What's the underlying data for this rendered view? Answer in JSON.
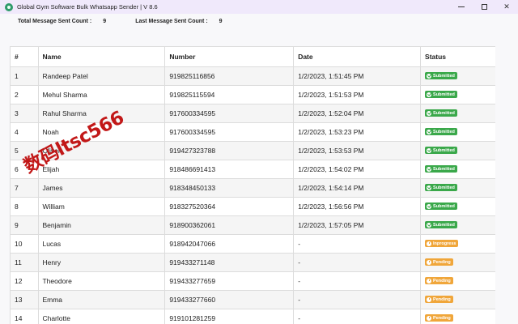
{
  "window": {
    "title": "Global Gym Software Bulk Whatsapp Sender | V 8.6",
    "controls": [
      "minimize",
      "maximize",
      "close"
    ],
    "close_glyph": "✕"
  },
  "counts": {
    "total_label": "Total Message Sent Count :",
    "total_value": "9",
    "last_label": "Last Message Sent Count :",
    "last_value": "9"
  },
  "table": {
    "headers": [
      "#",
      "Name",
      "Number",
      "Date",
      "Status"
    ],
    "rows": [
      {
        "n": "1",
        "name": "Randeep Patel",
        "number": "919825116856",
        "date": "1/2/2023, 1:51:45 PM",
        "status": "Submitted",
        "kind": "submitted"
      },
      {
        "n": "2",
        "name": "Mehul Sharma",
        "number": "919825115594",
        "date": "1/2/2023, 1:51:53 PM",
        "status": "Submitted",
        "kind": "submitted"
      },
      {
        "n": "3",
        "name": "Rahul Sharma",
        "number": "917600334595",
        "date": "1/2/2023, 1:52:04 PM",
        "status": "Submitted",
        "kind": "submitted"
      },
      {
        "n": "4",
        "name": "Noah",
        "number": "917600334595",
        "date": "1/2/2023, 1:53:23 PM",
        "status": "Submitted",
        "kind": "submitted"
      },
      {
        "n": "5",
        "name": "Oliver",
        "number": "919427323788",
        "date": "1/2/2023, 1:53:53 PM",
        "status": "Submitted",
        "kind": "submitted"
      },
      {
        "n": "6",
        "name": "Elijah",
        "number": "918486691413",
        "date": "1/2/2023, 1:54:02 PM",
        "status": "Submitted",
        "kind": "submitted"
      },
      {
        "n": "7",
        "name": "James",
        "number": "918348450133",
        "date": "1/2/2023, 1:54:14 PM",
        "status": "Submitted",
        "kind": "submitted"
      },
      {
        "n": "8",
        "name": "William",
        "number": "918327520364",
        "date": "1/2/2023, 1:56:56 PM",
        "status": "Submitted",
        "kind": "submitted"
      },
      {
        "n": "9",
        "name": "Benjamin",
        "number": "918900362061",
        "date": "1/2/2023, 1:57:05 PM",
        "status": "Submitted",
        "kind": "submitted"
      },
      {
        "n": "10",
        "name": "Lucas",
        "number": "918942047066",
        "date": "-",
        "status": "Inprogress",
        "kind": "inprogress"
      },
      {
        "n": "11",
        "name": "Henry",
        "number": "919433271148",
        "date": "-",
        "status": "Pending",
        "kind": "pending"
      },
      {
        "n": "12",
        "name": "Theodore",
        "number": "919433277659",
        "date": "-",
        "status": "Pending",
        "kind": "pending"
      },
      {
        "n": "13",
        "name": "Emma",
        "number": "919433277660",
        "date": "-",
        "status": "Pending",
        "kind": "pending"
      },
      {
        "n": "14",
        "name": "Charlotte",
        "number": "919101281259",
        "date": "-",
        "status": "Pending",
        "kind": "pending"
      }
    ]
  },
  "watermark": "数码ltsc566",
  "colors": {
    "titlebar_bg": "#f0e9fb",
    "submitted": "#3aa84a",
    "pending": "#f0a63a",
    "watermark": "#c21818"
  }
}
